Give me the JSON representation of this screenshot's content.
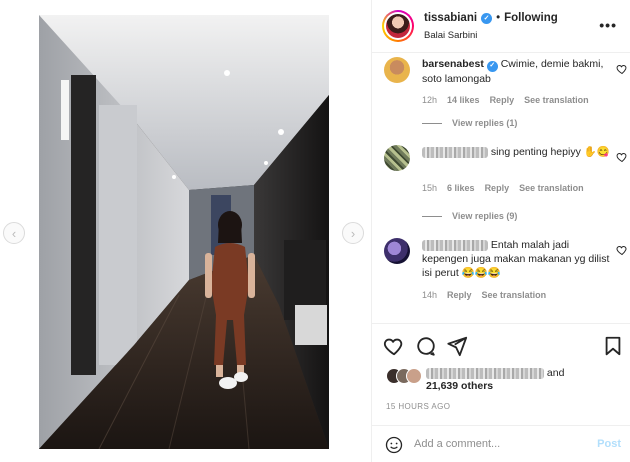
{
  "header": {
    "username": "tissabiani",
    "separator": "•",
    "follow_status": "Following",
    "location": "Balai Sarbini"
  },
  "comments": [
    {
      "username": "barsenabest",
      "text": "Cwimie, demie bakmi, soto lamongab",
      "time": "12h",
      "likes": "14 likes",
      "reply": "Reply",
      "translate": "See translation",
      "view_replies": "View replies (1)"
    },
    {
      "username": "",
      "text": "sing penting hepiyy ✋😋",
      "time": "15h",
      "likes": "6 likes",
      "reply": "Reply",
      "translate": "See translation",
      "view_replies": "View replies (9)"
    },
    {
      "username": "",
      "text": "Entah malah jadi kepengen juga makan makanan yg dilist isi perut 😂😂😂",
      "time": "14h",
      "reply": "Reply",
      "translate": "See translation"
    }
  ],
  "likes": {
    "prefix": "and",
    "count": "21,639 others"
  },
  "timestamp": "15 HOURS AGO",
  "add_comment": {
    "placeholder": "Add a comment...",
    "post_label": "Post"
  },
  "icons": {
    "verified": "verified-badge-icon",
    "more": "more-options-icon",
    "like": "heart-icon",
    "comment": "comment-icon",
    "share": "share-icon",
    "save": "bookmark-icon",
    "emoji": "emoji-icon",
    "prev": "chevron-left-icon",
    "next": "chevron-right-icon"
  },
  "colors": {
    "link_blue": "#3897f0",
    "post_disabled": "#b2dffc",
    "secondary_text": "#8e8e8e"
  }
}
